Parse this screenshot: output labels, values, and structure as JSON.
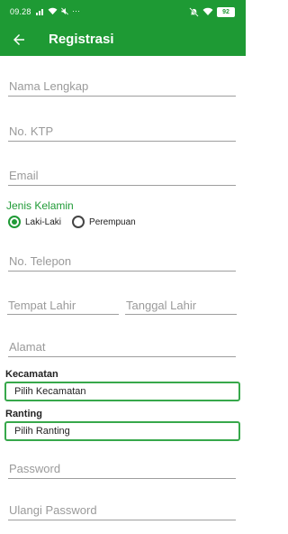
{
  "status_bar": {
    "time": "09.28",
    "battery": "92",
    "more": "···",
    "icons": [
      "signal-icon",
      "wifi-icon",
      "mute-icon",
      "wifi-icon"
    ]
  },
  "app_bar": {
    "title": "Registrasi",
    "back_icon": "arrow-left-icon"
  },
  "form": {
    "nama_lengkap": {
      "placeholder": "Nama Lengkap",
      "value": ""
    },
    "no_ktp": {
      "placeholder": "No. KTP",
      "value": ""
    },
    "email": {
      "placeholder": "Email",
      "value": ""
    },
    "jenis_kelamin": {
      "label": "Jenis Kelamin",
      "options": [
        {
          "label": "Laki-Laki",
          "selected": true
        },
        {
          "label": "Perempuan",
          "selected": false
        }
      ]
    },
    "no_telepon": {
      "placeholder": "No. Telepon",
      "value": ""
    },
    "tempat_lahir": {
      "placeholder": "Tempat Lahir",
      "value": ""
    },
    "tanggal_lahir": {
      "placeholder": "Tanggal Lahir",
      "value": ""
    },
    "alamat": {
      "placeholder": "Alamat",
      "value": ""
    },
    "kecamatan": {
      "label": "Kecamatan",
      "selected": "Pilih Kecamatan"
    },
    "ranting": {
      "label": "Ranting",
      "selected": "Pilih Ranting"
    },
    "password": {
      "placeholder": "Password",
      "value": ""
    },
    "ulangi_password": {
      "placeholder": "Ulangi Password",
      "value": ""
    }
  },
  "colors": {
    "primary": "#1e9a34",
    "accent": "#1f9a36",
    "select_border": "#37a84b",
    "hint": "#9a9a9a"
  }
}
